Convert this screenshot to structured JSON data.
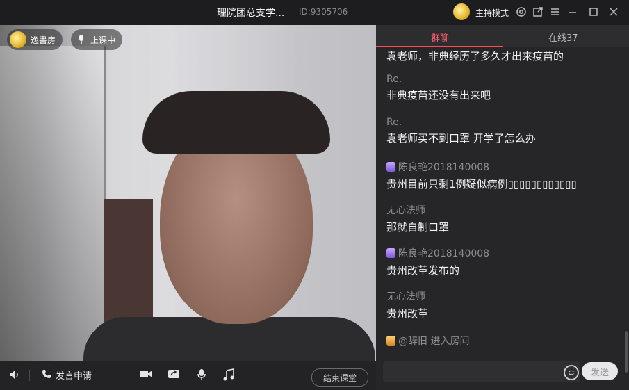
{
  "titlebar": {
    "title": "理院团总支学...",
    "room_id": "ID:9305706",
    "host_mode": "主持模式",
    "icons": [
      "settings-icon",
      "popout-icon",
      "menu-icon",
      "minimize-icon",
      "maximize-icon",
      "close-icon"
    ]
  },
  "video": {
    "teacher_name": "逸書房",
    "status": "上课中"
  },
  "controls": {
    "apply_speak": "发言申请",
    "end_class": "结束课堂"
  },
  "panel": {
    "tabs": {
      "group_chat": "群聊",
      "online": "在线37"
    },
    "messages": [
      {
        "sender": "",
        "text": "袁老师，非典经历了多久才出来疫苗的",
        "badge": "none"
      },
      {
        "sender": "Re.",
        "text": "非典疫苗还没有出来吧",
        "badge": "none"
      },
      {
        "sender": "Re.",
        "text": "袁老师买不到口罩 开学了怎么办",
        "badge": "none"
      },
      {
        "sender": "陈良艳2018140008",
        "text": "贵州目前只剩1例疑似病例▯▯▯▯▯▯▯▯▯▯▯▯",
        "badge": "purple"
      },
      {
        "sender": "无心法师",
        "text": "那就自制口罩",
        "badge": "none"
      },
      {
        "sender": "陈良艳2018140008",
        "text": "贵州改革发布的",
        "badge": "purple"
      },
      {
        "sender": "无心法师",
        "text": "贵州改革",
        "badge": "none"
      }
    ],
    "system_notice": {
      "user": "@辞旧",
      "action": "进入房间"
    },
    "send_label": "发送"
  },
  "colors": {
    "accent": "#ff4a5a",
    "panel_bg": "#262628",
    "titlebar_bg": "#1d1d1f"
  }
}
